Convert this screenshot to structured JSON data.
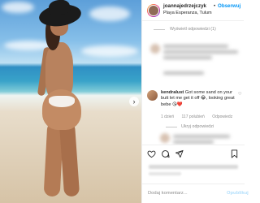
{
  "post": {
    "username": "joannajedrzejczyk",
    "separator": "•",
    "follow_label": "Obserwuj",
    "location": "Playa Esperanza, Tulum"
  },
  "comments": {
    "view_replies_label": "Wyświetl odpowiedzi (1)",
    "featured": {
      "username": "kendralust",
      "text": "Got some sand on your butt let me get it off 😂, looking great bebe 😘❤️",
      "age": "1 dzień",
      "likes": "117 polubień",
      "reply_label": "Odpowiedz"
    },
    "hide_replies_label": "Ukryj odpowiedzi"
  },
  "composer": {
    "placeholder": "Dodaj komentarz...",
    "post_label": "Opublikuj"
  },
  "colors": {
    "accent_blue": "#0095f6",
    "text": "#262626",
    "muted": "#8e8e8e",
    "border": "#efefef"
  },
  "icons": [
    "heart-icon",
    "comment-icon",
    "share-icon",
    "bookmark-icon",
    "chevron-right-icon"
  ]
}
